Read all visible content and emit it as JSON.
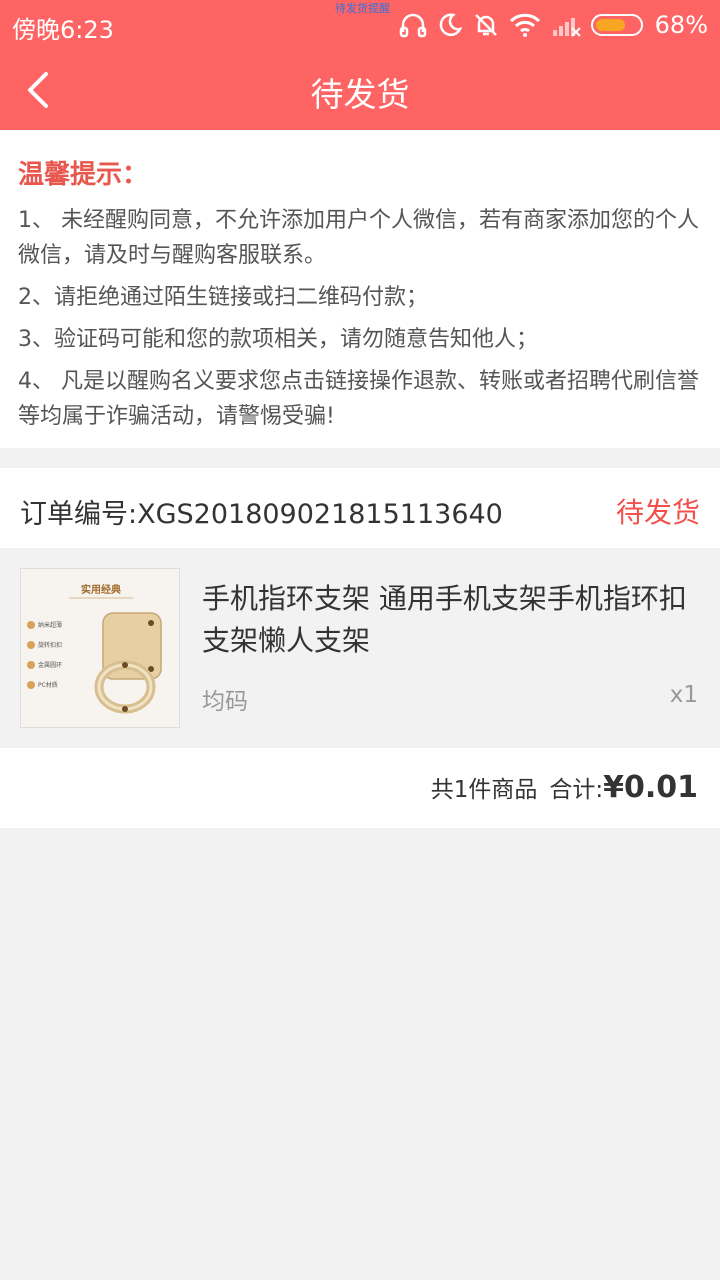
{
  "status_bar": {
    "time": "傍晚6:23",
    "notification_text": "待发货提醒",
    "battery_percent": "68%",
    "battery_level": 0.68
  },
  "nav": {
    "title": "待发货"
  },
  "notice": {
    "heading": "温馨提示：",
    "items": [
      "1、 未经醒购同意，不允许添加用户个人微信，若有商家添加您的个人微信，请及时与醒购客服联系。",
      "2、请拒绝通过陌生链接或扫二维码付款；",
      "3、验证码可能和您的款项相关，请勿随意告知他人；",
      "4、 凡是以醒购名义要求您点击链接操作退款、转账或者招聘代刷信誉等均属于诈骗活动，请警惕受骗!"
    ]
  },
  "order": {
    "number_label": "订单编号:XGS201809021815113640",
    "status": "待发货",
    "product": {
      "name": "手机指环支架 通用手机支架手机指环扣支架懒人支架",
      "spec": "均码",
      "quantity": "x1",
      "image_text": {
        "title": "实用经典",
        "features": [
          "纳米超薄",
          "旋转扣扣",
          "金属圆环",
          "PC材质"
        ]
      }
    },
    "summary": {
      "count_label": "共1件商品",
      "total_label": "合计:",
      "total_value": "¥0.01"
    }
  },
  "colors": {
    "header": "#fe6464",
    "accent_text": "#f2504a",
    "battery": "#f6a623"
  }
}
